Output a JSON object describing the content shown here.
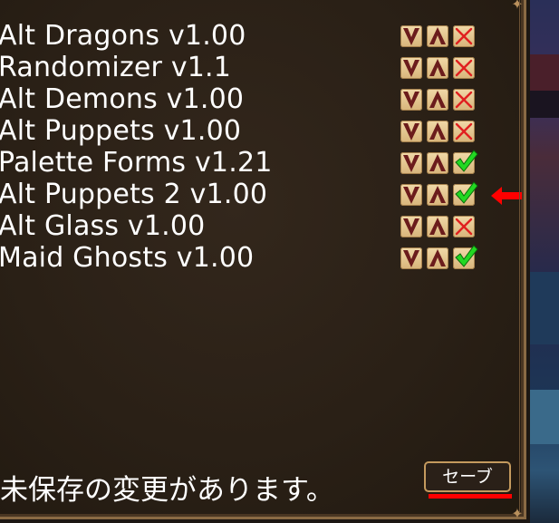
{
  "mods": [
    {
      "name": "Alt Dragons v1.00",
      "enabled": false
    },
    {
      "name": "Randomizer v1.1",
      "enabled": false
    },
    {
      "name": "Alt Demons v1.00",
      "enabled": false
    },
    {
      "name": "Alt Puppets v1.00",
      "enabled": false
    },
    {
      "name": "Palette Forms v1.21",
      "enabled": true
    },
    {
      "name": "Alt Puppets 2 v1.00",
      "enabled": true
    },
    {
      "name": "Alt Glass v1.00",
      "enabled": false
    },
    {
      "name": "Maid Ghosts v1.00",
      "enabled": true
    }
  ],
  "icons": {
    "move_down": "chevron-down-icon",
    "move_up": "chevron-up-icon",
    "enabled": "checkmark-icon",
    "disabled": "cross-icon",
    "annotation": "red-arrow-left-icon"
  },
  "status": {
    "message": "未保存の変更があります。"
  },
  "save_button": {
    "label": "セーブ"
  },
  "colors": {
    "panel_bg": "#2a2016",
    "border": "#8a6a44",
    "button_bg": "#e8cc95",
    "chevron": "#6b1c1c",
    "check": "#22d822",
    "cross": "#e02020",
    "annotation": "#ff0000"
  }
}
